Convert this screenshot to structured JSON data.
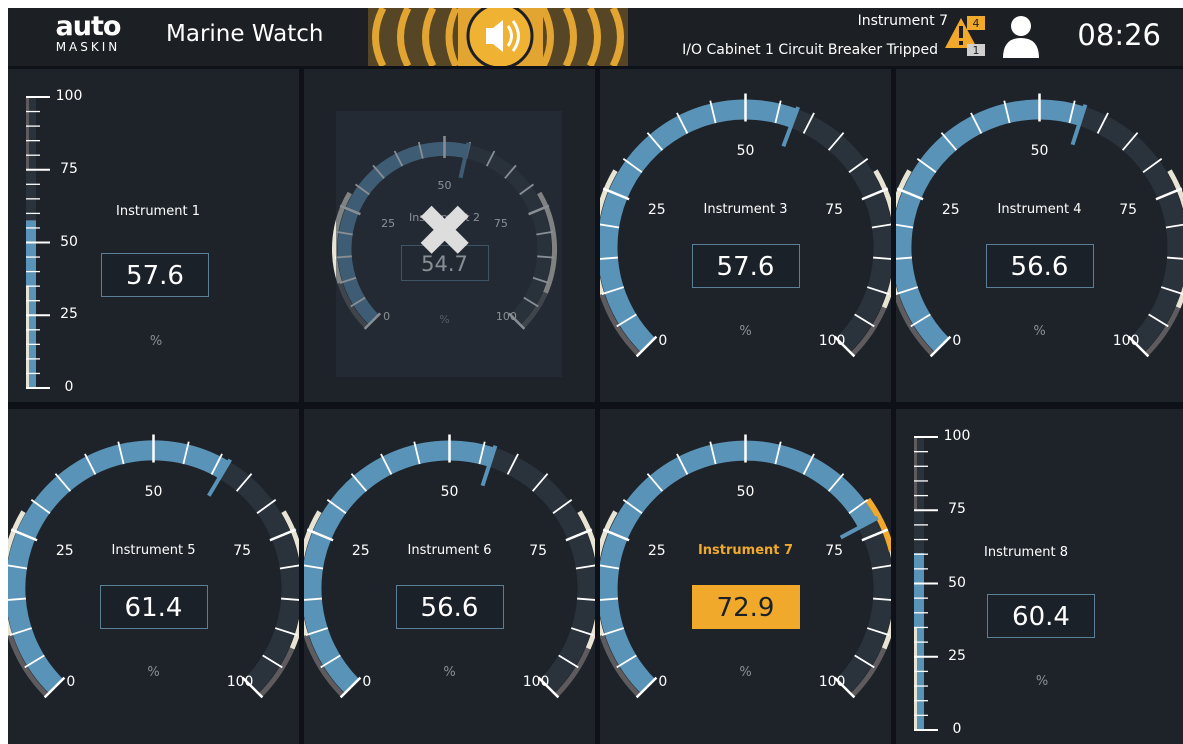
{
  "header": {
    "logo_top": "auto",
    "logo_bottom": "MASKIN",
    "title": "Marine Watch",
    "alarm_instrument": "Instrument 7",
    "alarm_message": "I/O Cabinet 1 Circuit Breaker Tripped",
    "alarm_count_active": "4",
    "alarm_count_ack": "1",
    "clock": "08:26"
  },
  "icons": {
    "logo": "automaskin-logo",
    "horn": "horn-icon",
    "alarm": "alarm-warning-icon",
    "user": "user-icon"
  },
  "colors": {
    "background": "#0e1218",
    "panel": "#1e232a",
    "value_arc": "#5a93b8",
    "track": "#2a323b",
    "alarm": "#f0a92b",
    "limit_low": "#5e5b5e",
    "limit_high": "#e8e4d4"
  },
  "instruments": [
    {
      "name": "Instrument 1",
      "value": "57.6",
      "unit": "%",
      "type": "bar",
      "level": 57.6,
      "ticks": [
        "100",
        "75",
        "50",
        "25",
        "0"
      ]
    },
    {
      "name": "Instrument 2",
      "value": "54.7",
      "unit": "%",
      "type": "gauge",
      "level": 54.7,
      "disabled": true,
      "labels": {
        "zero": "0",
        "q1": "25",
        "mid": "50",
        "q3": "75",
        "max": "100"
      }
    },
    {
      "name": "Instrument 3",
      "value": "57.6",
      "unit": "%",
      "type": "gauge",
      "level": 57.6,
      "labels": {
        "zero": "0",
        "q1": "25",
        "mid": "50",
        "q3": "75",
        "max": "100"
      }
    },
    {
      "name": "Instrument 4",
      "value": "56.6",
      "unit": "%",
      "type": "gauge",
      "level": 56.6,
      "labels": {
        "zero": "0",
        "q1": "25",
        "mid": "50",
        "q3": "75",
        "max": "100"
      }
    },
    {
      "name": "Instrument 5",
      "value": "61.4",
      "unit": "%",
      "type": "gauge",
      "level": 61.4,
      "labels": {
        "zero": "0",
        "q1": "25",
        "mid": "50",
        "q3": "75",
        "max": "100"
      }
    },
    {
      "name": "Instrument 6",
      "value": "56.6",
      "unit": "%",
      "type": "gauge",
      "level": 56.6,
      "labels": {
        "zero": "0",
        "q1": "25",
        "mid": "50",
        "q3": "75",
        "max": "100"
      }
    },
    {
      "name": "Instrument 7",
      "value": "72.9",
      "unit": "%",
      "type": "gauge",
      "level": 72.9,
      "alarm": true,
      "labels": {
        "zero": "0",
        "q1": "25",
        "mid": "50",
        "q3": "75",
        "max": "100"
      }
    },
    {
      "name": "Instrument 8",
      "value": "60.4",
      "unit": "%",
      "type": "bar",
      "level": 60.4,
      "ticks": [
        "100",
        "75",
        "50",
        "25",
        "0"
      ]
    }
  ]
}
